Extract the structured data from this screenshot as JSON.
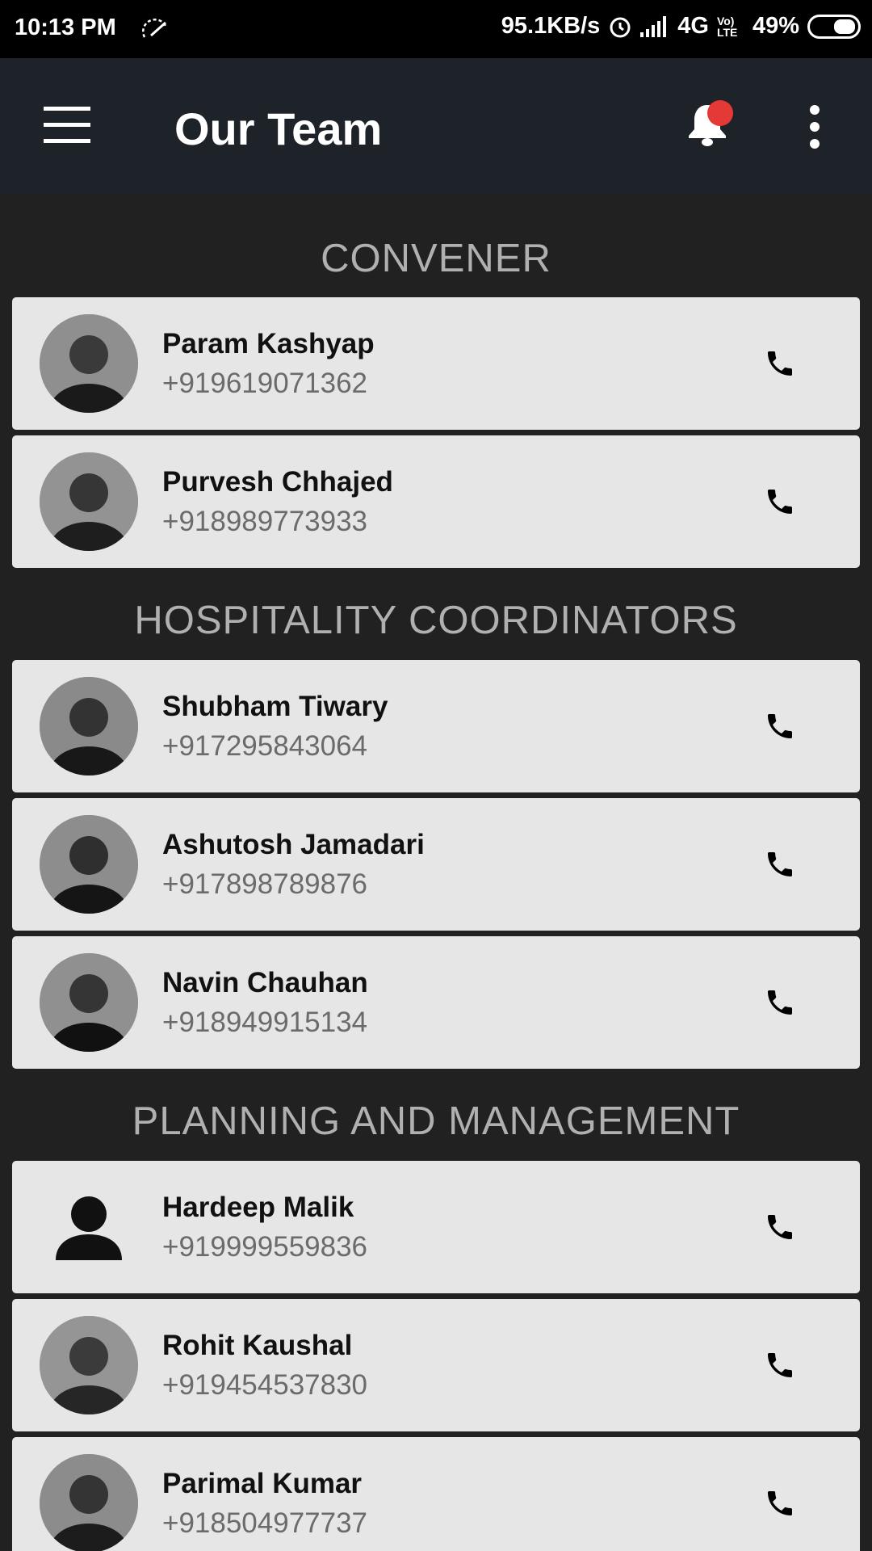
{
  "status_bar": {
    "time": "10:13 PM",
    "net_speed": "95.1KB/s",
    "network": "4G",
    "volte": "Vo) LTE",
    "battery": "49%"
  },
  "app_bar": {
    "title": "Our Team",
    "icons": [
      "menu-icon",
      "bell-icon",
      "more-vert-icon"
    ],
    "notification_dot_color": "#e53935"
  },
  "sections": [
    {
      "title": "CONVENER",
      "members": [
        {
          "name": "Param Kashyap",
          "phone": "+919619071362"
        },
        {
          "name": "Purvesh Chhajed",
          "phone": "+918989773933"
        }
      ]
    },
    {
      "title": "HOSPITALITY COORDINATORS",
      "members": [
        {
          "name": "Shubham Tiwary",
          "phone": "+917295843064"
        },
        {
          "name": "Ashutosh Jamadari",
          "phone": "+917898789876"
        },
        {
          "name": "Navin Chauhan",
          "phone": "+918949915134"
        }
      ]
    },
    {
      "title": "PLANNING AND MANAGEMENT",
      "members": [
        {
          "name": "Hardeep Malik",
          "phone": "+919999559836"
        },
        {
          "name": "Rohit Kaushal",
          "phone": "+919454537830"
        },
        {
          "name": "Parimal Kumar",
          "phone": "+918504977737"
        }
      ]
    }
  ]
}
